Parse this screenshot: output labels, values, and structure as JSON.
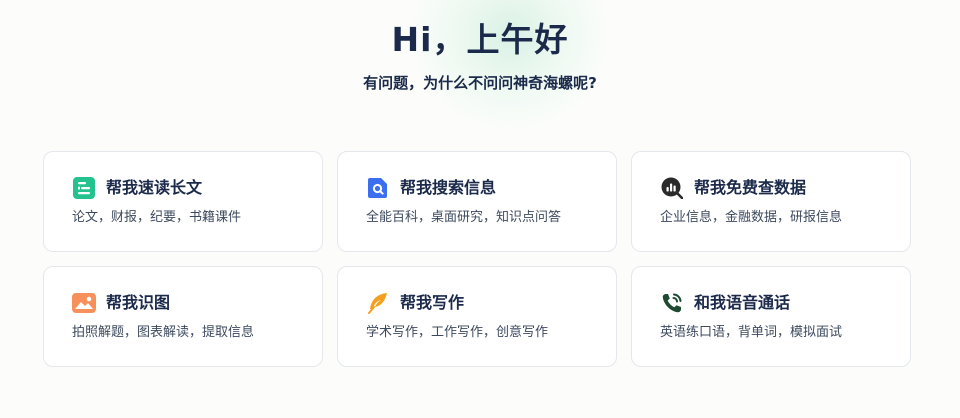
{
  "hero": {
    "greeting": "Hi，上午好",
    "subtitle": "有问题，为什么不问问神奇海螺呢?"
  },
  "cards": [
    {
      "title": "帮我速读长文",
      "desc": "论文，财报，纪要，书籍课件",
      "icon": "document-list-icon",
      "color": "#23c28f"
    },
    {
      "title": "帮我搜索信息",
      "desc": "全能百科，桌面研究，知识点问答",
      "icon": "search-document-icon",
      "color": "#3b6fef"
    },
    {
      "title": "帮我免费查数据",
      "desc": "企业信息，金融数据，研报信息",
      "icon": "bar-chart-magnifier-icon",
      "color": "#2a2a2a"
    },
    {
      "title": "帮我识图",
      "desc": "拍照解题，图表解读，提取信息",
      "icon": "image-icon",
      "color": "#f7905a"
    },
    {
      "title": "帮我写作",
      "desc": "学术写作，工作写作，创意写作",
      "icon": "feather-pen-icon",
      "color": "#f3a020"
    },
    {
      "title": "和我语音通话",
      "desc": "英语练口语，背单词，模拟面试",
      "icon": "phone-call-icon",
      "color": "#1e4a33"
    }
  ]
}
